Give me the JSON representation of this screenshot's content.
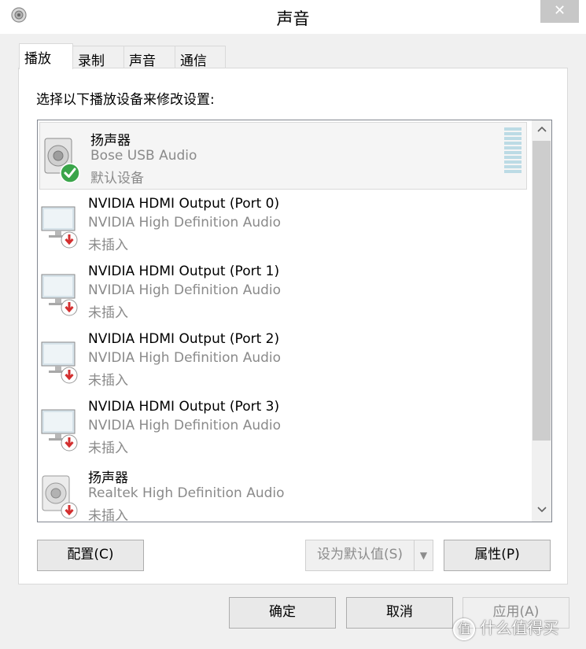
{
  "window": {
    "title": "声音",
    "close_glyph": "✕"
  },
  "tabs": [
    {
      "label": "播放",
      "active": true
    },
    {
      "label": "录制",
      "active": false
    },
    {
      "label": "声音",
      "active": false
    },
    {
      "label": "通信",
      "active": false
    }
  ],
  "playback": {
    "instruction": "选择以下播放设备来修改设置:",
    "devices": [
      {
        "name": "扬声器",
        "driver": "Bose USB Audio",
        "status": "默认设备",
        "icon": "speaker-icon",
        "badge": "default-check-icon",
        "selected": true
      },
      {
        "name": "NVIDIA HDMI Output (Port 0)",
        "driver": "NVIDIA High Definition Audio",
        "status": "未插入",
        "icon": "monitor-icon",
        "badge": "unplugged-icon",
        "selected": false
      },
      {
        "name": "NVIDIA HDMI Output (Port 1)",
        "driver": "NVIDIA High Definition Audio",
        "status": "未插入",
        "icon": "monitor-icon",
        "badge": "unplugged-icon",
        "selected": false
      },
      {
        "name": "NVIDIA HDMI Output (Port 2)",
        "driver": "NVIDIA High Definition Audio",
        "status": "未插入",
        "icon": "monitor-icon",
        "badge": "unplugged-icon",
        "selected": false
      },
      {
        "name": "NVIDIA HDMI Output (Port 3)",
        "driver": "NVIDIA High Definition Audio",
        "status": "未插入",
        "icon": "monitor-icon",
        "badge": "unplugged-icon",
        "selected": false
      },
      {
        "name": "扬声器",
        "driver": "Realtek High Definition Audio",
        "status": "未插入",
        "icon": "speaker-icon",
        "badge": "unplugged-icon",
        "selected": false
      }
    ],
    "configure_label": "配置(C)",
    "set_default_label": "设为默认值(S)",
    "properties_label": "属性(P)"
  },
  "footer": {
    "ok_label": "确定",
    "cancel_label": "取消",
    "apply_label": "应用(A)"
  },
  "watermark": {
    "logo_glyph": "值",
    "text": "什么值得买"
  },
  "colors": {
    "accent_check": "#3aa54a",
    "unplugged_red": "#d32f2f",
    "level_meter": "#bcdbe5"
  }
}
